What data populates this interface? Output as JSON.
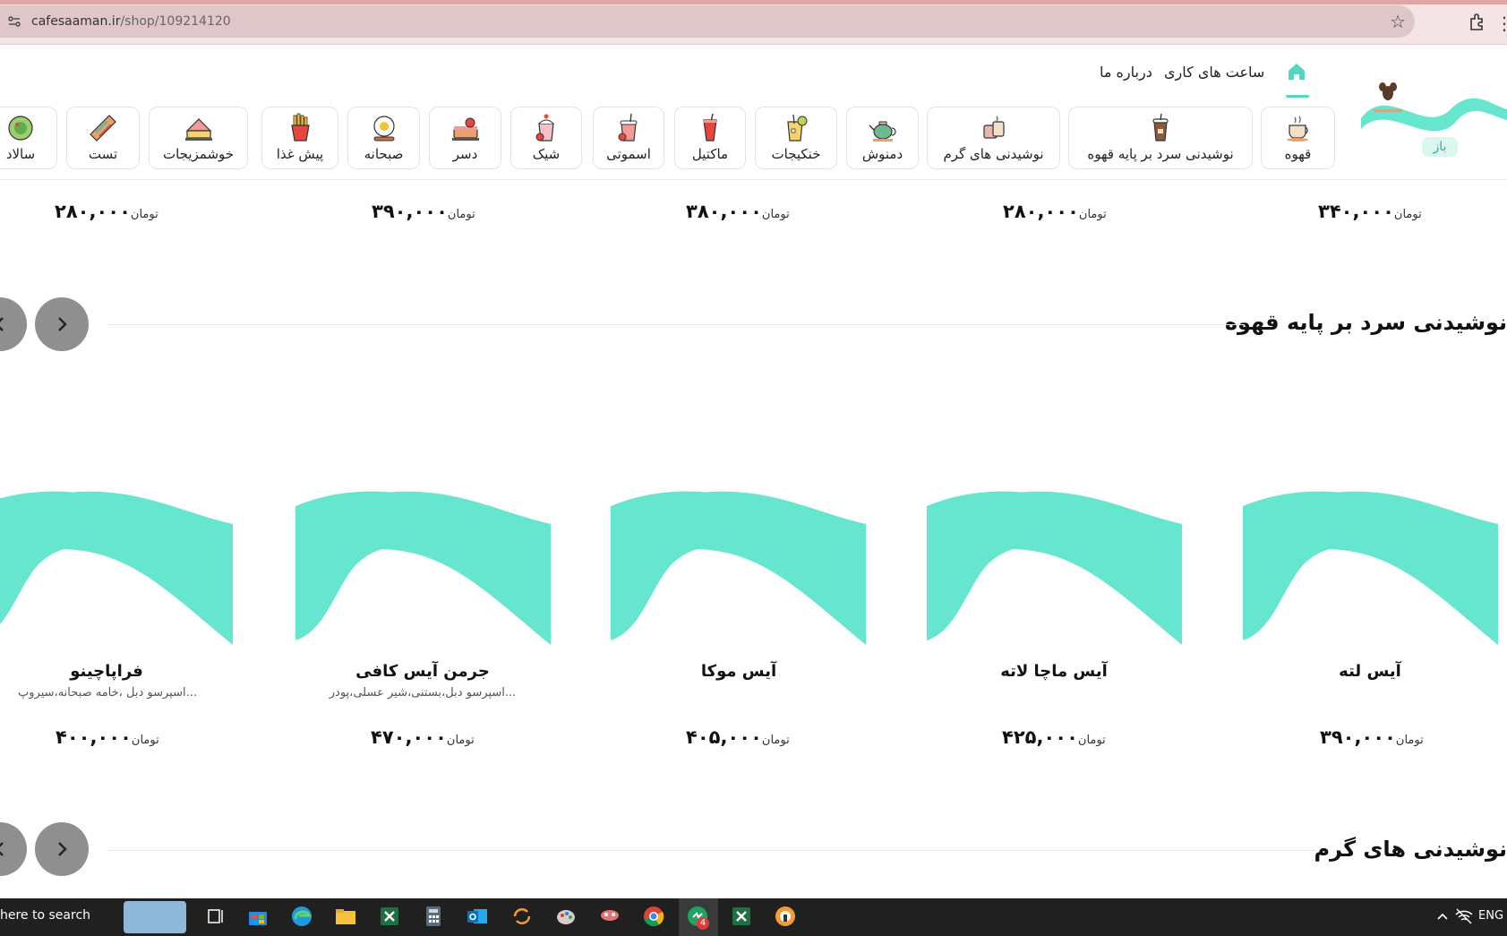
{
  "browser": {
    "url_domain": "cafesaaman.ir",
    "url_path": "/shop/109214120"
  },
  "header": {
    "open_badge": "باز",
    "nav_hours": "ساعت های کاری",
    "nav_about": "درباره ما"
  },
  "categories": [
    {
      "label": "قهوه",
      "icon": "coffee-cup-icon"
    },
    {
      "label": "نوشیدنی سرد بر پایه قهوه",
      "icon": "iced-coffee-icon"
    },
    {
      "label": "نوشیدنی های گرم",
      "icon": "hot-drink-icon"
    },
    {
      "label": "دمنوش",
      "icon": "teapot-icon"
    },
    {
      "label": "خنکیجات",
      "icon": "lemonade-icon"
    },
    {
      "label": "ماکتیل",
      "icon": "mocktail-icon"
    },
    {
      "label": "اسموتی",
      "icon": "smoothie-icon"
    },
    {
      "label": "شیک",
      "icon": "shake-icon"
    },
    {
      "label": "دسر",
      "icon": "dessert-icon"
    },
    {
      "label": "صبحانه",
      "icon": "breakfast-icon"
    },
    {
      "label": "پیش غذا",
      "icon": "fries-icon"
    },
    {
      "label": "خوشمزیجات",
      "icon": "cake-icon"
    },
    {
      "label": "تست",
      "icon": "toast-icon"
    },
    {
      "label": "سالاد",
      "icon": "salad-icon"
    }
  ],
  "currency": "تومان",
  "top_prices": [
    "۳۴۰,۰۰۰",
    "۲۸۰,۰۰۰",
    "۳۸۰,۰۰۰",
    "۳۹۰,۰۰۰",
    "۲۸۰,۰۰۰"
  ],
  "section_cold": {
    "title": "نوشیدنی سرد بر پایه قهوه",
    "products": [
      {
        "name": "آیس لته",
        "desc": "",
        "price": "۳۹۰,۰۰۰"
      },
      {
        "name": "آیس ماچا لاته",
        "desc": "",
        "price": "۴۲۵,۰۰۰"
      },
      {
        "name": "آیس موکا",
        "desc": "",
        "price": "۴۰۵,۰۰۰"
      },
      {
        "name": "جرمن آیس کافی",
        "desc": "اسپرسو دبل،بستنی،شیر عسلی،پودر...",
        "price": "۴۷۰,۰۰۰"
      },
      {
        "name": "فراپاچینو",
        "desc": "اسپرسو دبل ،خامه صبحانه،سیروپ...",
        "price": "۴۰۰,۰۰۰"
      }
    ]
  },
  "section_hot": {
    "title": "نوشیدنی های گرم"
  },
  "taskbar": {
    "search_text": "here to search",
    "lang": "ENG",
    "badge": "4"
  },
  "colors": {
    "brand": "#66e6cf",
    "accent": "#55d6bf",
    "taskbar": "#202020"
  }
}
